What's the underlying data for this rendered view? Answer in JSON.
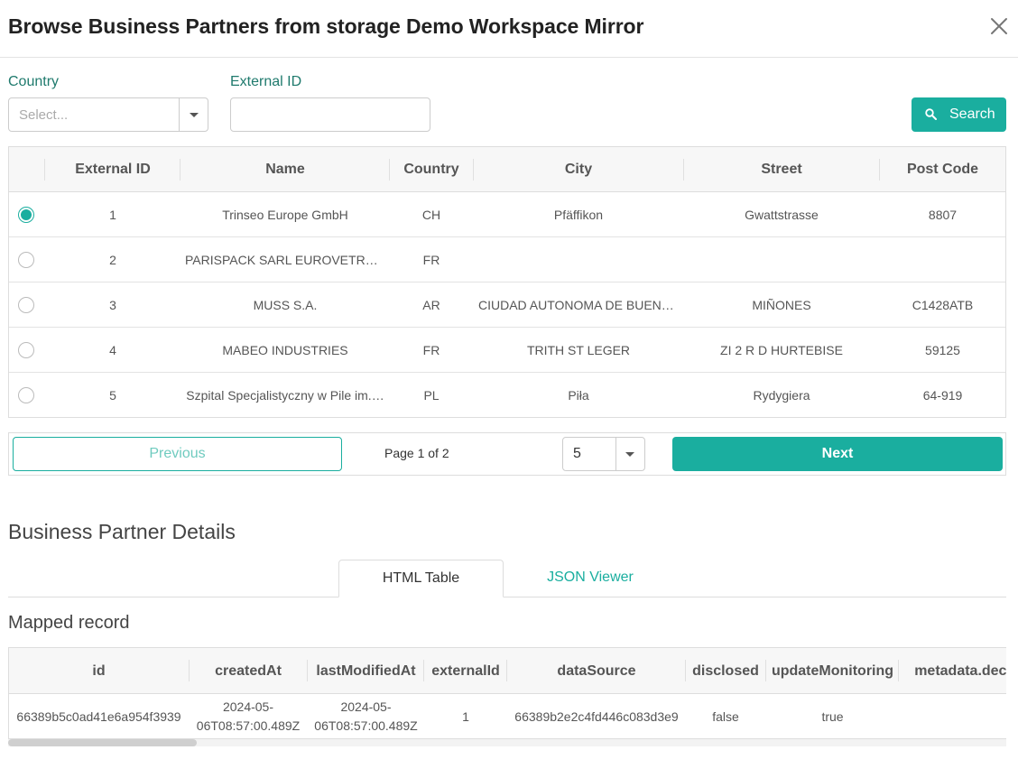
{
  "dialog": {
    "title": "Browse Business Partners from storage Demo Workspace Mirror"
  },
  "filters": {
    "country_label": "Country",
    "country_placeholder": "Select...",
    "external_id_label": "External ID",
    "external_id_value": "",
    "search_label": "Search"
  },
  "table": {
    "columns": [
      "External ID",
      "Name",
      "Country",
      "City",
      "Street",
      "Post Code"
    ],
    "rows": [
      {
        "selected": true,
        "cells": [
          "1",
          "Trinseo Europe GmbH",
          "CH",
          "Pfäffikon",
          "Gwattstrasse",
          "8807"
        ]
      },
      {
        "selected": false,
        "cells": [
          "2",
          "PARISPACK SARL EUROVETROC…",
          "FR",
          "",
          "",
          ""
        ]
      },
      {
        "selected": false,
        "cells": [
          "3",
          "MUSS S.A.",
          "AR",
          "CIUDAD AUTONOMA DE BUENO…",
          "MIÑONES",
          "C1428ATB"
        ]
      },
      {
        "selected": false,
        "cells": [
          "4",
          "MABEO INDUSTRIES",
          "FR",
          "TRITH ST LEGER",
          "ZI 2 R D HURTEBISE",
          "59125"
        ]
      },
      {
        "selected": false,
        "cells": [
          "5",
          "Szpital Specjalistyczny w Pile im.…",
          "PL",
          "Piła",
          "Rydygiera",
          "64-919"
        ]
      }
    ]
  },
  "pagination": {
    "previous_label": "Previous",
    "page_info": "Page 1 of 2",
    "page_size": "5",
    "next_label": "Next"
  },
  "details": {
    "title": "Business Partner Details",
    "tabs": [
      "HTML Table",
      "JSON Viewer"
    ],
    "active_tab": "HTML Table",
    "subtitle": "Mapped record",
    "columns": [
      "id",
      "createdAt",
      "lastModifiedAt",
      "externalId",
      "dataSource",
      "disclosed",
      "updateMonitoring",
      "metadata.decis"
    ],
    "row": {
      "id": "66389b5c0ad41e6a954f3939",
      "createdAt_line1": "2024-05-",
      "createdAt_line2": "06T08:57:00.489Z",
      "lastModifiedAt_line1": "2024-05-",
      "lastModifiedAt_line2": "06T08:57:00.489Z",
      "externalId": "1",
      "dataSource": "66389b2e2c4fd446c083d3e9",
      "disclosed": "false",
      "updateMonitoring": "true",
      "metadata": ""
    }
  },
  "colors": {
    "accent": "#1aae9f",
    "label": "#1f7a6d"
  },
  "icons": {
    "close": "close-icon",
    "search": "search-icon",
    "dropdown": "chevron-down-icon"
  }
}
